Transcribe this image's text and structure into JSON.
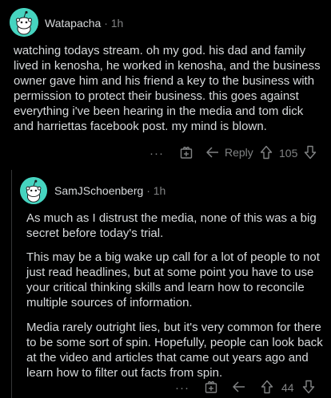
{
  "comments": [
    {
      "username": "Watapacha",
      "separator": "·",
      "time": "1h",
      "paragraphs": [
        "watching todays stream. oh my god. his dad and family lived in kenosha, he worked in kenosha, and the business owner gave him and his friend a key to the business with permission to protect their business. this goes against everything i've been hearing in the media and tom dick and harriettas facebook post. my mind is blown."
      ],
      "actions": {
        "more_label": "···",
        "reply_label": "Reply",
        "vote_count": "105"
      }
    },
    {
      "username": "SamJSchoenberg",
      "separator": "·",
      "time": "1h",
      "paragraphs": [
        "As much as I distrust the media, none of this was a big secret before today's trial.",
        "This may be a big wake up call for a lot of people to not just read headlines, but at some point you have to use your critical thinking skills and learn how to reconcile multiple sources of information.",
        "Media rarely outright lies, but it's very common for there to be some sort of spin.  Hopefully, people can look back at the video and articles that came out years ago and learn how to filter out facts from spin."
      ],
      "actions": {
        "more_label": "···",
        "vote_count": "44"
      }
    }
  ],
  "colors": {
    "background": "#000000",
    "text": "#d7dadc",
    "meta": "#818384",
    "avatar": "#46d4c0",
    "thread_line": "#343536"
  },
  "icons": [
    "snoo-avatar-icon",
    "award-gift-icon",
    "reply-arrow-icon",
    "upvote-arrow-icon",
    "downvote-arrow-icon",
    "more-dots-icon"
  ]
}
